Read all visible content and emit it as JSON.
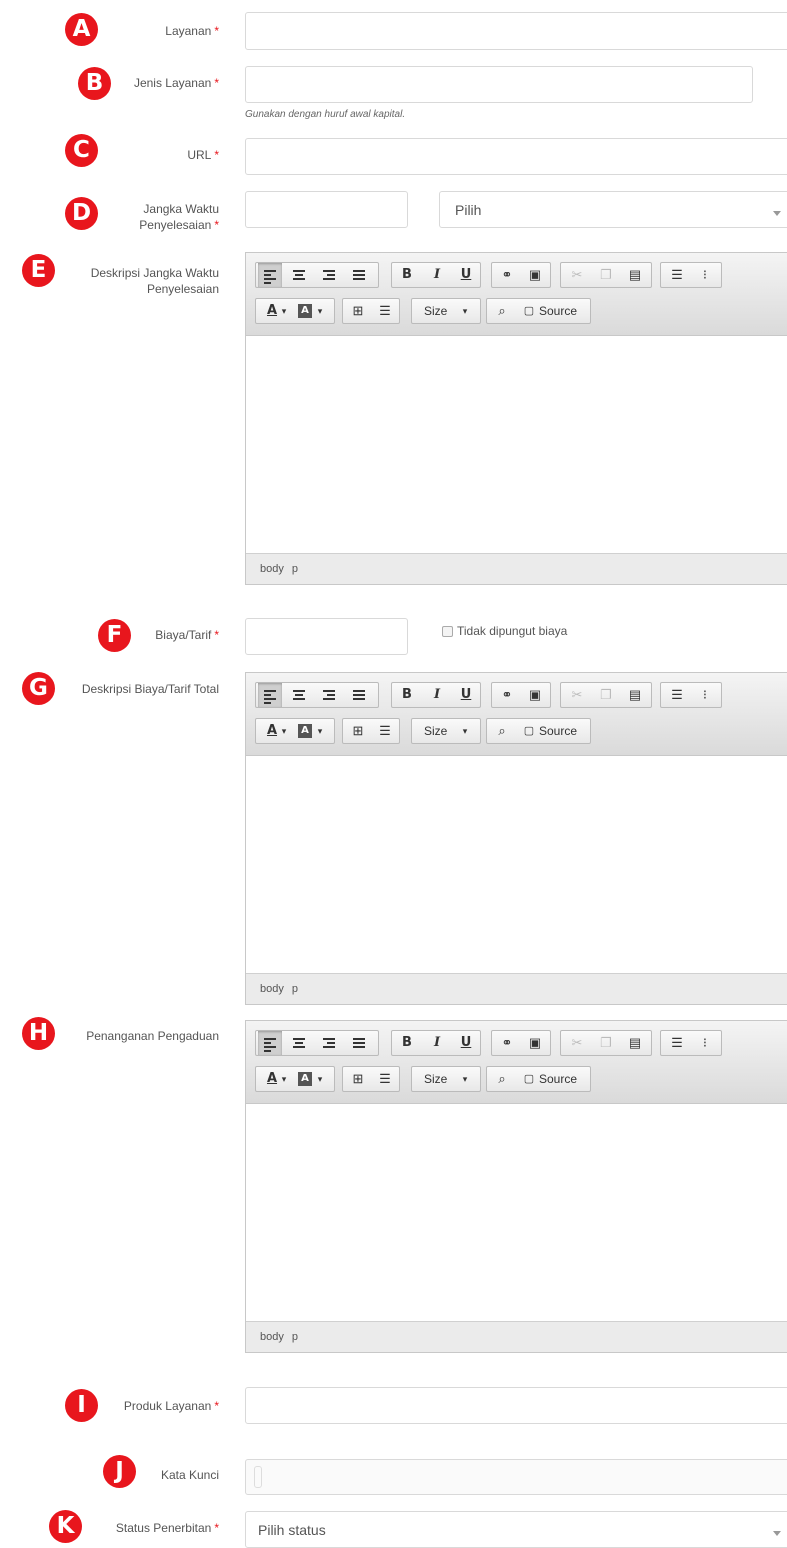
{
  "badges": [
    "A",
    "B",
    "C",
    "D",
    "E",
    "F",
    "G",
    "H",
    "I",
    "J",
    "K"
  ],
  "required_mark": "*",
  "fields": {
    "layanan": {
      "label": "Layanan",
      "value": ""
    },
    "jenis_layanan": {
      "label": "Jenis Layanan",
      "value": "",
      "hint": "Gunakan dengan huruf awal kapital."
    },
    "url": {
      "label": "URL",
      "value": ""
    },
    "jangka_waktu": {
      "label_line1": "Jangka Waktu",
      "label_line2": "Penyelesaian",
      "value": "",
      "select_value": "Pilih"
    },
    "deskripsi_jangka": {
      "label_line1": "Deskripsi Jangka Waktu",
      "label_line2": "Penyelesaian"
    },
    "biaya": {
      "label": "Biaya/Tarif",
      "value": "",
      "checkbox_label": "Tidak dipungut biaya",
      "checked": false
    },
    "deskripsi_biaya": {
      "label": "Deskripsi Biaya/Tarif Total"
    },
    "pengaduan": {
      "label": "Penanganan Pengaduan"
    },
    "produk": {
      "label": "Produk Layanan",
      "value": ""
    },
    "kata_kunci": {
      "label": "Kata Kunci",
      "value": ""
    },
    "status": {
      "label": "Status Penerbitan",
      "select_value": "Pilih status"
    }
  },
  "editor": {
    "buttons": {
      "bold": "B",
      "italic": "I",
      "underline": "U",
      "text_color": "A",
      "bg_color": "A",
      "size": "Size",
      "source": "Source"
    },
    "path": [
      "body",
      "p"
    ],
    "icons": [
      "align-left-icon",
      "align-center-icon",
      "align-right-icon",
      "align-justify-icon",
      "link-icon",
      "image-icon",
      "cut-icon",
      "copy-icon",
      "paste-icon",
      "numbered-list-icon",
      "bulleted-list-icon",
      "table-icon",
      "horizontal-rule-icon",
      "preview-icon",
      "source-icon"
    ]
  },
  "colors": {
    "badge": "#e8161d",
    "required": "#e8161d",
    "border": "#d9d9d9",
    "toolbar": "#e4e4e4"
  }
}
